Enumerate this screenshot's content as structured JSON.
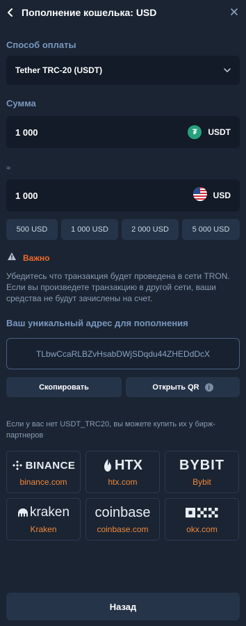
{
  "header": {
    "title": "Пополнение кошелька: USD",
    "back_icon": "chevron-left-icon",
    "close_icon": "close-icon"
  },
  "payment": {
    "label": "Способ оплаты",
    "selected": "Tether TRC-20 (USDT)"
  },
  "amount": {
    "label": "Сумма",
    "value": "1 000",
    "currency": "USDT",
    "coin_icon": "tether-icon",
    "coin_glyph": "₮",
    "coin_color": "#26a17b"
  },
  "converted": {
    "approx": "≈",
    "value": "1 000",
    "currency": "USD",
    "flag_icon": "us-flag-icon"
  },
  "quick_amounts": [
    "500 USD",
    "1 000 USD",
    "2 000 USD",
    "5 000 USD"
  ],
  "warning": {
    "title": "Важно",
    "text": "Убедитесь что транзакция будет проведена в сети TRON. Если вы произведете транзакцию в другой сети, ваши средства не будут зачислены на счет.",
    "accent": "#f06a2a"
  },
  "address": {
    "label": "Ваш уникальный адрес для пополнения",
    "value": "TLbwCcaRLBZvHsabDWjSDqdu44ZHEDdDcX"
  },
  "actions": {
    "copy": "Скопировать",
    "qr": "Открыть QR",
    "qr_info_icon": "info-icon"
  },
  "partners_note": "Если у вас нет USDT_TRC20, вы можете купить их у бирж-партнеров",
  "partners": [
    {
      "logo": "BINANCE",
      "link": "binance.com"
    },
    {
      "logo": "HTX",
      "link": "htx.com"
    },
    {
      "logo": "BYBIT",
      "link": "Bybit"
    },
    {
      "logo": "kraken",
      "link": "Kraken"
    },
    {
      "logo": "coinbase",
      "link": "coinbase.com"
    },
    {
      "logo": "OKX",
      "link": "okx.com"
    }
  ],
  "footer": {
    "back": "Назад"
  }
}
